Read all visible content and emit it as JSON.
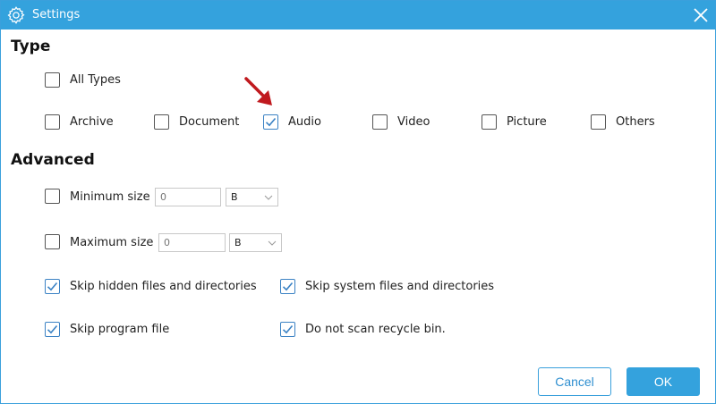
{
  "window": {
    "title": "Settings"
  },
  "type_section": {
    "title": "Type",
    "all_types": {
      "label": "All Types",
      "checked": false
    },
    "options": [
      {
        "label": "Archive",
        "checked": false
      },
      {
        "label": "Document",
        "checked": false
      },
      {
        "label": "Audio",
        "checked": true
      },
      {
        "label": "Video",
        "checked": false
      },
      {
        "label": "Picture",
        "checked": false
      },
      {
        "label": "Others",
        "checked": false
      }
    ]
  },
  "advanced_section": {
    "title": "Advanced",
    "min_size": {
      "label": "Minimum size",
      "checked": false,
      "placeholder": "0",
      "unit": "B"
    },
    "max_size": {
      "label": "Maximum size",
      "checked": false,
      "placeholder": "0",
      "unit": "B"
    },
    "options": [
      {
        "label": "Skip hidden files and directories",
        "checked": true
      },
      {
        "label": "Skip system files and directories",
        "checked": true
      },
      {
        "label": "Skip program file",
        "checked": true
      },
      {
        "label": "Do not scan recycle bin.",
        "checked": true
      }
    ]
  },
  "buttons": {
    "cancel": "Cancel",
    "ok": "OK"
  },
  "colors": {
    "accent": "#34a2dd",
    "check": "#3b82c4",
    "arrow": "#c0191e"
  },
  "icons": {
    "title": "gear-icon",
    "close": "close-icon",
    "annotation": "red-arrow-icon"
  }
}
